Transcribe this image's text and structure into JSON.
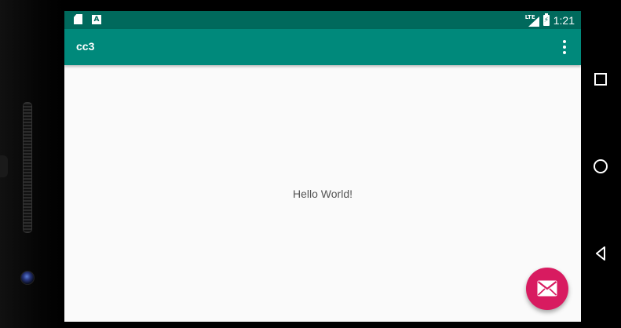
{
  "status_bar": {
    "network": "LTE",
    "time": "1:21",
    "left_icons": [
      "sd-card-icon",
      "a-notification-icon"
    ],
    "right_icons": [
      "signal-icon",
      "battery-charging-icon"
    ]
  },
  "app_bar": {
    "title": "cc3",
    "overflow_icon": "more-vert-icon"
  },
  "content": {
    "text": "Hello World!"
  },
  "fab": {
    "icon": "email-icon",
    "color": "#d81b60"
  },
  "nav_bar": {
    "buttons": [
      "recents-icon",
      "home-icon",
      "back-icon"
    ]
  },
  "colors": {
    "status_bar": "#00695c",
    "app_bar": "#00897b",
    "background": "#fafafa",
    "accent": "#d81b60"
  }
}
